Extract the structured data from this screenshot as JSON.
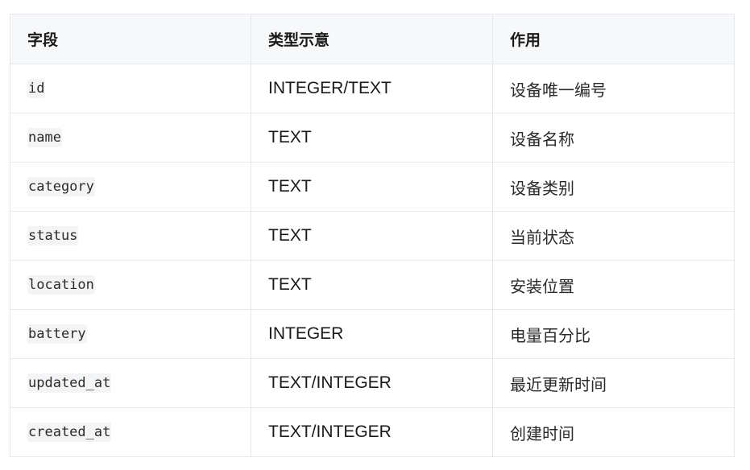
{
  "table": {
    "headers": [
      "字段",
      "类型示意",
      "作用"
    ],
    "rows": [
      {
        "field": "id",
        "type": "INTEGER/TEXT",
        "purpose": "设备唯一编号"
      },
      {
        "field": "name",
        "type": "TEXT",
        "purpose": "设备名称"
      },
      {
        "field": "category",
        "type": "TEXT",
        "purpose": "设备类别"
      },
      {
        "field": "status",
        "type": "TEXT",
        "purpose": "当前状态"
      },
      {
        "field": "location",
        "type": "TEXT",
        "purpose": "安装位置"
      },
      {
        "field": "battery",
        "type": "INTEGER",
        "purpose": "电量百分比"
      },
      {
        "field": "updated_at",
        "type": "TEXT/INTEGER",
        "purpose": "最近更新时间"
      },
      {
        "field": "created_at",
        "type": "TEXT/INTEGER",
        "purpose": "创建时间"
      }
    ]
  }
}
